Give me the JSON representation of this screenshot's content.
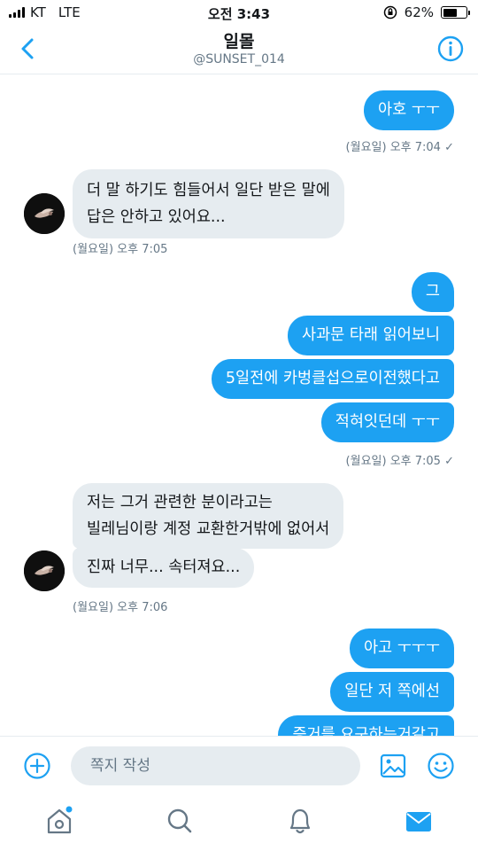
{
  "status_bar": {
    "carrier": "KT",
    "network": "LTE",
    "time": "오전 3:43",
    "battery_percent": "62%",
    "battery_level": 0.62
  },
  "header": {
    "title": "일몰",
    "handle": "@SUNSET_014",
    "back_icon": "chevron-left-icon",
    "info_icon": "info-circle-icon"
  },
  "messages": [
    {
      "side": "sent",
      "text": "아호 ㅜㅜ"
    },
    {
      "meta": "(월요일) 오후 7:04"
    },
    {
      "side": "received",
      "text": "더 말 하기도 힘들어서 일단 받은 말에"
    },
    {
      "side": "received",
      "text": "답은 안하고 있어요..."
    },
    {
      "meta": "(월요일) 오후 7:05"
    },
    {
      "side": "sent",
      "text": "그"
    },
    {
      "side": "sent",
      "text": "사과문 타래 읽어보니"
    },
    {
      "side": "sent",
      "text": "5일전에 카벙클섭으로이전했다고"
    },
    {
      "side": "sent",
      "text": "적혀잇던데 ㅜㅜ"
    },
    {
      "meta": "(월요일) 오후 7:05"
    },
    {
      "side": "received",
      "text": "저는 그거 관련한 분이라고는"
    },
    {
      "side": "received",
      "text": "빌레님이랑 계정 교환한거밖에 없어서"
    },
    {
      "side": "received",
      "text": "진짜 너무... 속터져요..."
    },
    {
      "meta": "(월요일) 오후 7:06"
    },
    {
      "side": "sent",
      "text": "아고 ㅜㅜㅜ"
    },
    {
      "side": "sent",
      "text": "일단 저 쪽에선"
    },
    {
      "side": "sent",
      "text": "증거를 요구하는거같고"
    }
  ],
  "composer": {
    "placeholder": "쪽지 작성",
    "add_icon": "plus-circle-icon",
    "media_icon": "image-icon",
    "emoji_icon": "emoji-icon"
  },
  "tab_bar": {
    "items": [
      "home-icon",
      "search-icon",
      "bell-icon",
      "mail-icon"
    ],
    "active": "mail-icon"
  },
  "colors": {
    "accent": "#1da1f2",
    "received_bubble": "#e6ecf0",
    "meta_text": "#657786"
  }
}
